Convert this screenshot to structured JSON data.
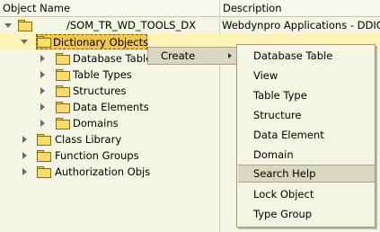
{
  "header": {
    "col1": "Object Name",
    "col2": "Description"
  },
  "root": {
    "name": "/SOM_TR_WD_TOOLS_DX",
    "description": "Webdynpro Applications - DDIC"
  },
  "selected": {
    "label": "Dictionary Objects"
  },
  "tree": {
    "children": [
      "Database Table",
      "Table Types",
      "Structures",
      "Data Elements",
      "Domains"
    ],
    "siblings": [
      "Class Library",
      "Function Groups",
      "Authorization Objs"
    ]
  },
  "context_menu": {
    "create_label": "Create"
  },
  "submenu": {
    "items": [
      {
        "label": "Database Table"
      },
      {
        "label": "View"
      },
      {
        "label": "Table Type"
      },
      {
        "label": "Structure"
      },
      {
        "label": "Data Element"
      },
      {
        "label": "Domain"
      },
      {
        "label": "Search Help"
      },
      {
        "label": "Lock Object"
      },
      {
        "label": "Type Group"
      }
    ],
    "highlighted": "Search Help"
  }
}
